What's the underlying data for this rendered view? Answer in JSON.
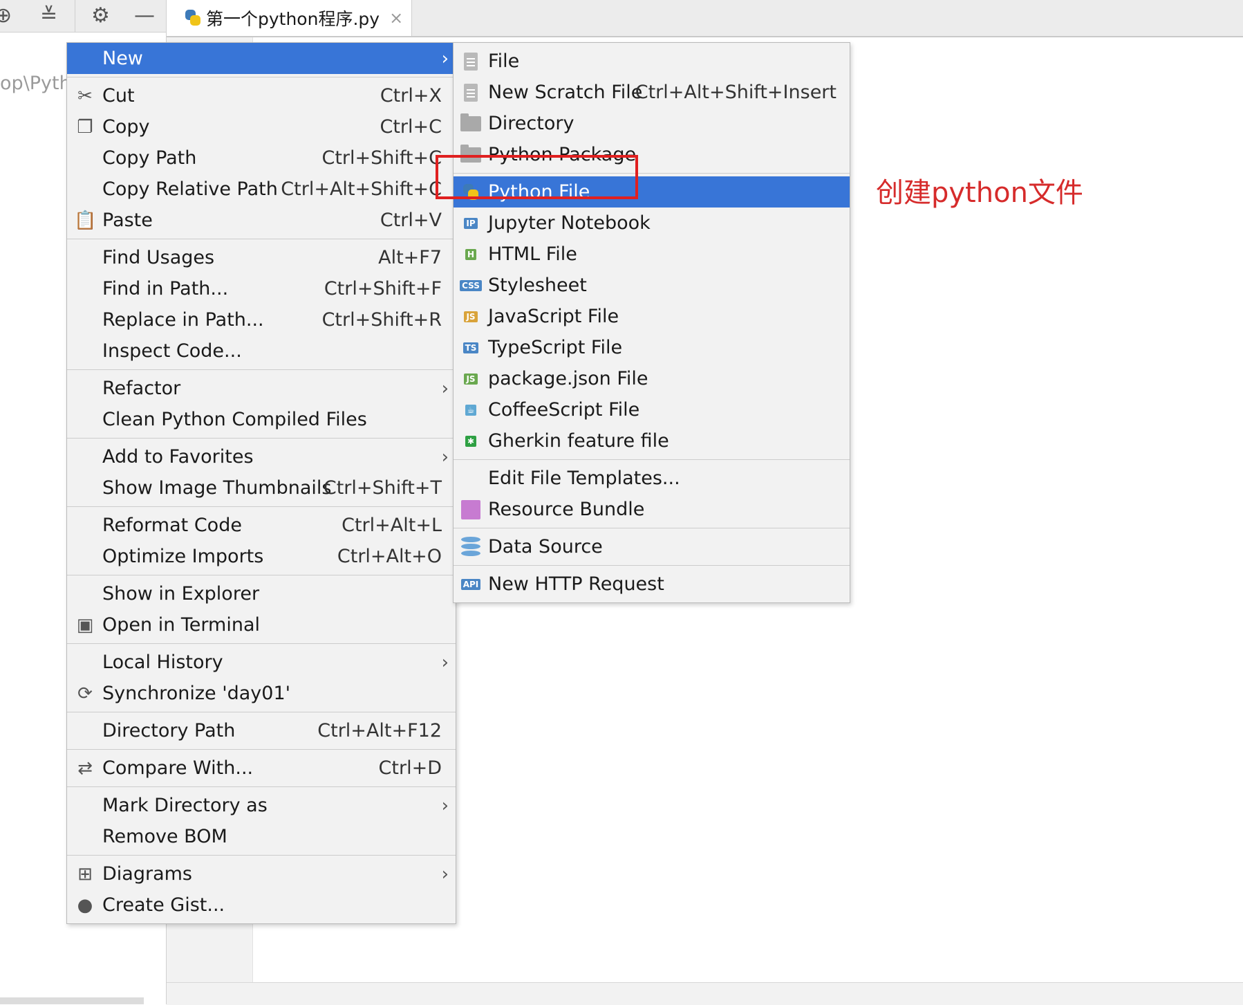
{
  "tab": {
    "title": "第一个python程序.py",
    "close_glyph": "×"
  },
  "project_pane": {
    "path_text": "op\\Pyth"
  },
  "annotation": {
    "text": "创建python文件",
    "color": "#d62b2b"
  },
  "colors": {
    "selection": "#3875d7",
    "highlight_box": "#e02020"
  },
  "main_menu": {
    "items": [
      {
        "label": "New",
        "shortcut": "",
        "icon": "",
        "submenu": true,
        "selected": true
      },
      {
        "sep": true
      },
      {
        "label": "Cut",
        "shortcut": "Ctrl+X",
        "icon": "✂"
      },
      {
        "label": "Copy",
        "shortcut": "Ctrl+C",
        "icon": "❐"
      },
      {
        "label": "Copy Path",
        "shortcut": "Ctrl+Shift+C"
      },
      {
        "label": "Copy Relative Path",
        "shortcut": "Ctrl+Alt+Shift+C"
      },
      {
        "label": "Paste",
        "shortcut": "Ctrl+V",
        "icon": "📋"
      },
      {
        "sep": true
      },
      {
        "label": "Find Usages",
        "shortcut": "Alt+F7"
      },
      {
        "label": "Find in Path...",
        "shortcut": "Ctrl+Shift+F"
      },
      {
        "label": "Replace in Path...",
        "shortcut": "Ctrl+Shift+R"
      },
      {
        "label": "Inspect Code...",
        "shortcut": ""
      },
      {
        "sep": true
      },
      {
        "label": "Refactor",
        "shortcut": "",
        "submenu": true
      },
      {
        "label": "Clean Python Compiled Files",
        "shortcut": ""
      },
      {
        "sep": true
      },
      {
        "label": "Add to Favorites",
        "shortcut": "",
        "submenu": true
      },
      {
        "label": "Show Image Thumbnails",
        "shortcut": "Ctrl+Shift+T"
      },
      {
        "sep": true
      },
      {
        "label": "Reformat Code",
        "shortcut": "Ctrl+Alt+L"
      },
      {
        "label": "Optimize Imports",
        "shortcut": "Ctrl+Alt+O"
      },
      {
        "sep": true
      },
      {
        "label": "Show in Explorer",
        "shortcut": ""
      },
      {
        "label": "Open in Terminal",
        "shortcut": "",
        "icon": "▣"
      },
      {
        "sep": true
      },
      {
        "label": "Local History",
        "shortcut": "",
        "submenu": true
      },
      {
        "label": "Synchronize 'day01'",
        "shortcut": "",
        "icon": "⟳"
      },
      {
        "sep": true
      },
      {
        "label": "Directory Path",
        "shortcut": "Ctrl+Alt+F12"
      },
      {
        "sep": true
      },
      {
        "label": "Compare With...",
        "shortcut": "Ctrl+D",
        "icon": "⇄"
      },
      {
        "sep": true
      },
      {
        "label": "Mark Directory as",
        "shortcut": "",
        "submenu": true
      },
      {
        "label": "Remove BOM",
        "shortcut": ""
      },
      {
        "sep": true
      },
      {
        "label": "Diagrams",
        "shortcut": "",
        "submenu": true,
        "icon": "⊞"
      },
      {
        "label": "Create Gist...",
        "shortcut": "",
        "icon": "●"
      }
    ]
  },
  "sub_menu": {
    "items": [
      {
        "label": "File",
        "shortcut": "",
        "icon": "doc"
      },
      {
        "label": "New Scratch File",
        "shortcut": "Ctrl+Alt+Shift+Insert",
        "icon": "doc"
      },
      {
        "label": "Directory",
        "shortcut": "",
        "icon": "folder"
      },
      {
        "label": "Python Package",
        "shortcut": "",
        "icon": "folder"
      },
      {
        "sep": true
      },
      {
        "label": "Python File",
        "shortcut": "",
        "icon": "python",
        "selected": true
      },
      {
        "label": "Jupyter Notebook",
        "shortcut": "",
        "icon": "badge",
        "badge": "IP",
        "badge_color": "#4a86c5"
      },
      {
        "label": "HTML File",
        "shortcut": "",
        "icon": "badge",
        "badge": "H",
        "badge_color": "#6aa84f"
      },
      {
        "label": "Stylesheet",
        "shortcut": "",
        "icon": "badge",
        "badge": "CSS",
        "badge_color": "#4a86c5"
      },
      {
        "label": "JavaScript File",
        "shortcut": "",
        "icon": "badge",
        "badge": "JS",
        "badge_color": "#d9a33a"
      },
      {
        "label": "TypeScript File",
        "shortcut": "",
        "icon": "badge",
        "badge": "TS",
        "badge_color": "#4a86c5"
      },
      {
        "label": "package.json File",
        "shortcut": "",
        "icon": "badge",
        "badge": "JS",
        "badge_color": "#6aa84f"
      },
      {
        "label": "CoffeeScript File",
        "shortcut": "",
        "icon": "badge",
        "badge": "☕",
        "badge_color": "#5fa8d3"
      },
      {
        "label": "Gherkin feature file",
        "shortcut": "",
        "icon": "badge",
        "badge": "✱",
        "badge_color": "#2ea043"
      },
      {
        "sep": true
      },
      {
        "label": "Edit File Templates...",
        "shortcut": "",
        "icon": ""
      },
      {
        "label": "Resource Bundle",
        "shortcut": "",
        "icon": "cube"
      },
      {
        "sep": true
      },
      {
        "label": "Data Source",
        "shortcut": "",
        "icon": "stack"
      },
      {
        "sep": true
      },
      {
        "label": "New HTTP Request",
        "shortcut": "",
        "icon": "badge",
        "badge": "API",
        "badge_color": "#4a86c5"
      }
    ]
  }
}
